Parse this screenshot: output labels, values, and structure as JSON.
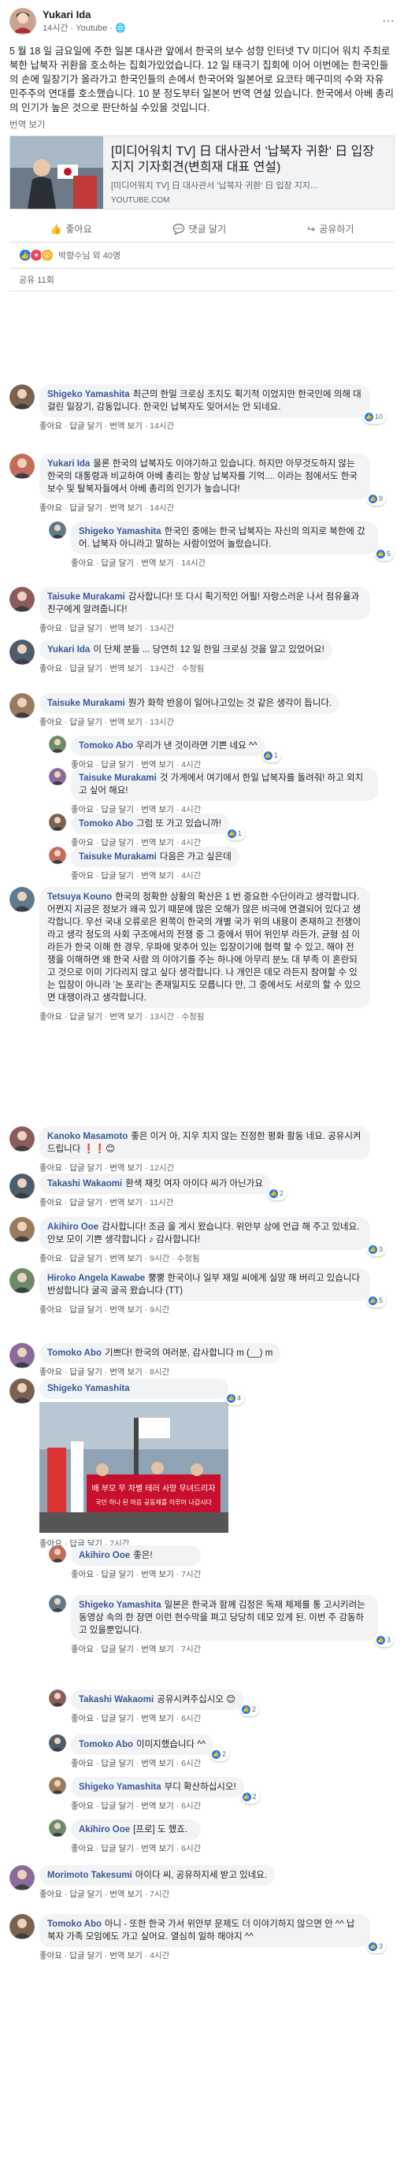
{
  "post": {
    "author": "Yukari Ida",
    "meta": "14시간 · Youtube · ",
    "body": "5 월 18 일 금요일에 주한 일본 대사관 앞에서 한국의 보수 성향 인터넷 TV 미디어 워치 주최로 북한 납북자 귀환을 호소하는 집회가있었습니다. 12 일 태극기 집회에 이어 이번에는 한국인들의 손에 일장기가 올라가고 한국인들의 손에서 한국어와 일본어로 요코타 메구미의 수와 자유 민주주의 연대를 호소했습니다. 10 분 정도부터 일본어 번역 연설 있습니다. 한국에서 아베 총리의 인기가 높은 것으로 판단하실 수있을 것입니다.",
    "translate": "번역 보기",
    "link": {
      "title": "[미디어워치 TV] 日 대사관서 '납북자 귀환' 日 입장 지지 기자회견(변희재 대표 연설)",
      "desc": "[미디어워치 TV] 日 대사관서 '납북자 귀환' 日 입장 지지...",
      "domain": "YOUTUBE.COM"
    },
    "actions": {
      "like": "좋아요",
      "comment": "댓글 달기",
      "share": "공유하기"
    },
    "reactions": "박향수님 외 40명",
    "shares": "공유 11회"
  },
  "ui": {
    "like": "좋아요",
    "reply": "답글 달기",
    "translate": "번역 보기",
    "edited": "수정됨",
    "sep": "·",
    "reply_prompt": "..."
  },
  "comments": [
    {
      "name": "Shigeko Yamashita",
      "text": "최근의 한일 크로싱 조치도 획기적 이었지만 한국인에 의해 대걸린 일장기, 감동입니다. 한국인 납북자도 잊어서는 안 되네요.",
      "time": "14시간",
      "react": "10",
      "translate": true
    },
    {
      "name": "Yukari Ida",
      "text": "물론 한국의 납북자도 이야기하고 있습니다. 하지만 아무것도하지 않는 한국의 대통령과 비교하여 아베 총리는 항상 납북자를 기억.... 이라는 점에서도 한국 보수 및 탈북자들에서 아베 총리의 인기가 높습니다!",
      "time": "14시간",
      "react": "9",
      "translate": true
    },
    {
      "name": "Shigeko Yamashita",
      "text": "한국인 중에는 한국 납북자는 자신의 의지로 북한에 갔어. 납북자 아니라고 말하는 사람이었어 놀랐습니다.",
      "time": "14시간",
      "react": "5",
      "translate": true
    },
    {
      "name": "Taisuke Murakami",
      "text": "감사합니다! 또 다시 획기적인 어필! 자랑스러운 나서 점유율과 친구에게 알려줍니다!",
      "time": "13시간",
      "react": "",
      "translate": true
    },
    {
      "name": "Yukari Ida",
      "text": "이 단체 분들 ... 당연히 12 일 한일 크로싱 것을 알고 있었어요!",
      "time": "13시간",
      "react": "",
      "translate": true,
      "edited": true
    },
    {
      "name": "Taisuke Murakami",
      "text": "뭔가 화학 반응이 일어나고있는 것 같은 생각이 듭니다.",
      "time": "13시간",
      "react": "",
      "translate": true
    },
    {
      "name": "Tomoko Abo",
      "text": "우리가 낸 것이라면 기쁜 네요 ^^",
      "time": "4시간",
      "react": "1",
      "translate": true
    },
    {
      "name": "Taisuke Murakami",
      "text": "것 가게에서 여기에서 한일 납북자를 돌려줘! 하고 외치고 싶어 해요!",
      "time": "4시간",
      "react": "",
      "translate": true
    },
    {
      "name": "Tomoko Abo",
      "text": "그럼 또 가고 있습니까!",
      "time": "4시간",
      "react": "1",
      "translate": true
    },
    {
      "name": "Taisuke Murakami",
      "text": "다음은 가고 싶은데",
      "time": "4시간",
      "react": "",
      "translate": true
    },
    {
      "name": "Tetsuya Kouno",
      "text": "한국의 정확한 상황의 확산은 1 번 중요한 수단이라고 생각합니다. 어쩐지 지금은 정보가 왜곡 있기 때문에 많은 오해가 많은 비극에 연결되어 있다고 생각합니다. 우선 국내 오류로은 왼쪽이 한국의 개별 국가 위의 내용이 존재하고 전쟁이라고 생각 정도의 사회 구조에서의 전쟁 중 그 중에서 뛰어 위인부 라든가, 균형 섬 이라든가 한국 이해 한 경우, 우파에 맞추어 있는 입장이기에 협력 할 수 있고, 해야 전쟁을 이해하면 왜 한국 사람 의 이야기를 주는 하나에 아무리 분노 대 부족 이 혼란되고 것으로 이미 기다리지 않고 싶다 생각합니다. 나 개인은 데모 라든지 참여할 수 있는 입장이 아니라 '논 포리'는 존재일지도 모릅니다 만, 그 중에서도 서로의 할 수 있으면 대쟁이라고 생각합니다.",
      "time": "13시간",
      "react": "",
      "translate": true,
      "edited": true
    },
    {
      "name": "Kanoko Masamoto",
      "text": "좋은 이거 아, 지우 치지 않는 진정한 평화 활동 네요. 공유시켜드립니다 ❗❗😊",
      "time": "12시간",
      "react": "",
      "translate": true
    },
    {
      "name": "Takashi Wakaomi",
      "text": "환색 재킷 여자 아이다 씨가 아닌가요",
      "time": "11시간",
      "react": "2",
      "translate": true
    },
    {
      "name": "Akihiro Ooe",
      "text": "감사합니다! 조금 을 게시 왔습니다. 위안부 상에 언급 해 주고 있네요. 안보 모이 기쁜 생각합니다 ♪ 감사합니다!",
      "time": "9시간",
      "react": "3",
      "translate": true,
      "edited": true
    },
    {
      "name": "Hiroko Angela Kawabe",
      "text": "뿡뿡 한국이나 일부 재일 씨에게 실망 해 버리고 있습니다 반성합니다 굴곡 굴곡 왔습니다 (TT)",
      "time": "9시간",
      "react": "5",
      "translate": true
    },
    {
      "name": "Tomoko Abo",
      "text": "기쁘다! 한국의 여러분, 감사합니다 m (__) m",
      "time": "8시간",
      "react": "",
      "translate": true
    },
    {
      "name": "Shigeko Yamashita",
      "text": "",
      "time": "7시간",
      "react": "4",
      "translate": false,
      "image": true,
      "banner": "배 부모 무 차별 테러 사망 무녀드리자",
      "banner2": "국민 하나 된 마음 공동체를 이루어 나갑시다"
    },
    {
      "name": "Akihiro Ooe",
      "text": "좋은!",
      "time": "7시간",
      "react": "",
      "translate": true
    },
    {
      "name": "Shigeko Yamashita",
      "text": "일본은 한국과 함께 김정은 독재 체제를 통 고시키려는 동영상 속의 한 장면 이런 현수막을 펴고 당당히 데모 있게 된. 이번 주 강동하고 있을뿐입니다.",
      "time": "7시간",
      "react": "3",
      "translate": true
    },
    {
      "name": "Takashi Wakaomi",
      "text": "공유시켜주십시오 😊",
      "time": "6시간",
      "react": "2",
      "translate": true
    },
    {
      "name": "Tomoko Abo",
      "text": "이미지했습니다 ^^",
      "time": "6시간",
      "react": "2",
      "translate": true
    },
    {
      "name": "Shigeko Yamashita",
      "text": "부디 확산하십시오!",
      "time": "6시간",
      "react": "2",
      "translate": true
    },
    {
      "name": "Akihiro Ooe",
      "text": "[프로] 도 했죠.",
      "time": "6시간",
      "react": "",
      "translate": true
    },
    {
      "name": "Morimoto Takesumi",
      "text": "아이다 씨, 공유하지세 받고 있네요.",
      "time": "7시간",
      "react": "",
      "translate": true
    },
    {
      "name": "Tomoko Abo",
      "text": "아니 - 또한 한국 가서 위안부 문제도 더 이야기하지 않으면 안 ^^ 납북자 가족 모임에도 가고 싶어요. 열심히 일하 해야지 ^^",
      "time": "4시간",
      "react": "3",
      "translate": true
    }
  ]
}
